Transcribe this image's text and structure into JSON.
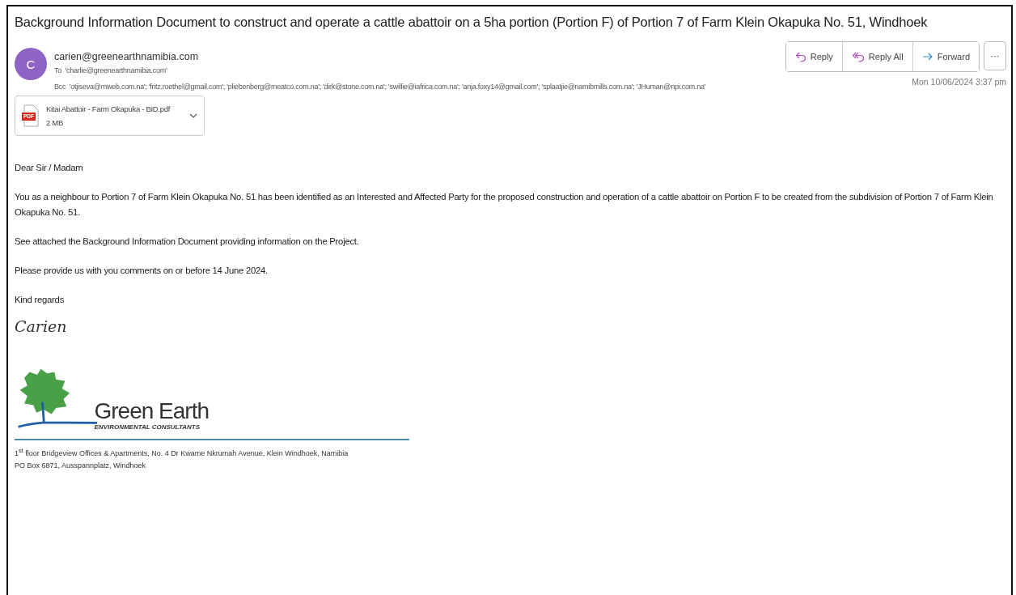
{
  "subject": "Background Information Document to construct and operate a cattle abattoir on a 5ha portion (Portion F) of Portion 7 of Farm Klein Okapuka No. 51, Windhoek",
  "sender": {
    "initial": "C",
    "email": "carien@greenearthnamibia.com",
    "to_label": "To",
    "to": "'charlie@greenearthnamibia.com'",
    "bcc_label": "Bcc",
    "bcc": "'otjiseva@mweb.com.na'; 'fritz.roethel@gmail.com'; 'pliebenberg@meatco.com.na'; 'dirk@stone.com.na'; 'swillie@iafrica.com.na'; 'anja.foxy14@gmail.com'; 'splaatjie@namibmills.com.na'; 'JHuman@npi.com.na'"
  },
  "actions": [
    {
      "kind": "reply",
      "label": "Reply"
    },
    {
      "kind": "reply_all",
      "label": "Reply All"
    },
    {
      "kind": "forward",
      "label": "Forward"
    }
  ],
  "more": "···",
  "date": "Mon 10/06/2024 3:37 pm",
  "attachment": {
    "badge": "PDF",
    "name": "Kitai Abattoir - Farm Okapuka - BID.pdf",
    "size": "2 MB"
  },
  "body": [
    "Dear Sir / Madam",
    "You as a neighbour to Portion 7 of Farm Klein Okapuka No. 51 has been identified as an Interested and Affected Party for the proposed construction and operation of a cattle abattoir on Portion F to be created from the subdivision of Portion 7 of Farm Klein Okapuka No. 51.",
    "See attached the Background Information Document providing information on the Project.",
    "Please provide us with you comments on or before 14 June 2024.",
    "Kind regards"
  ],
  "signature": "Carien",
  "logo": {
    "name": "Green Earth",
    "tagline": "ENVIRONMENTAL CONSULTANTS"
  },
  "address": [
    "1$^{st}$ floor Bridgeview Offices & Apartments, No. 4 Dr Kwame Nkrumah Avenue, Klein Windhoek, Namibia",
    "PO Box 6871, Ausspannplatz, Windhoek"
  ]
}
